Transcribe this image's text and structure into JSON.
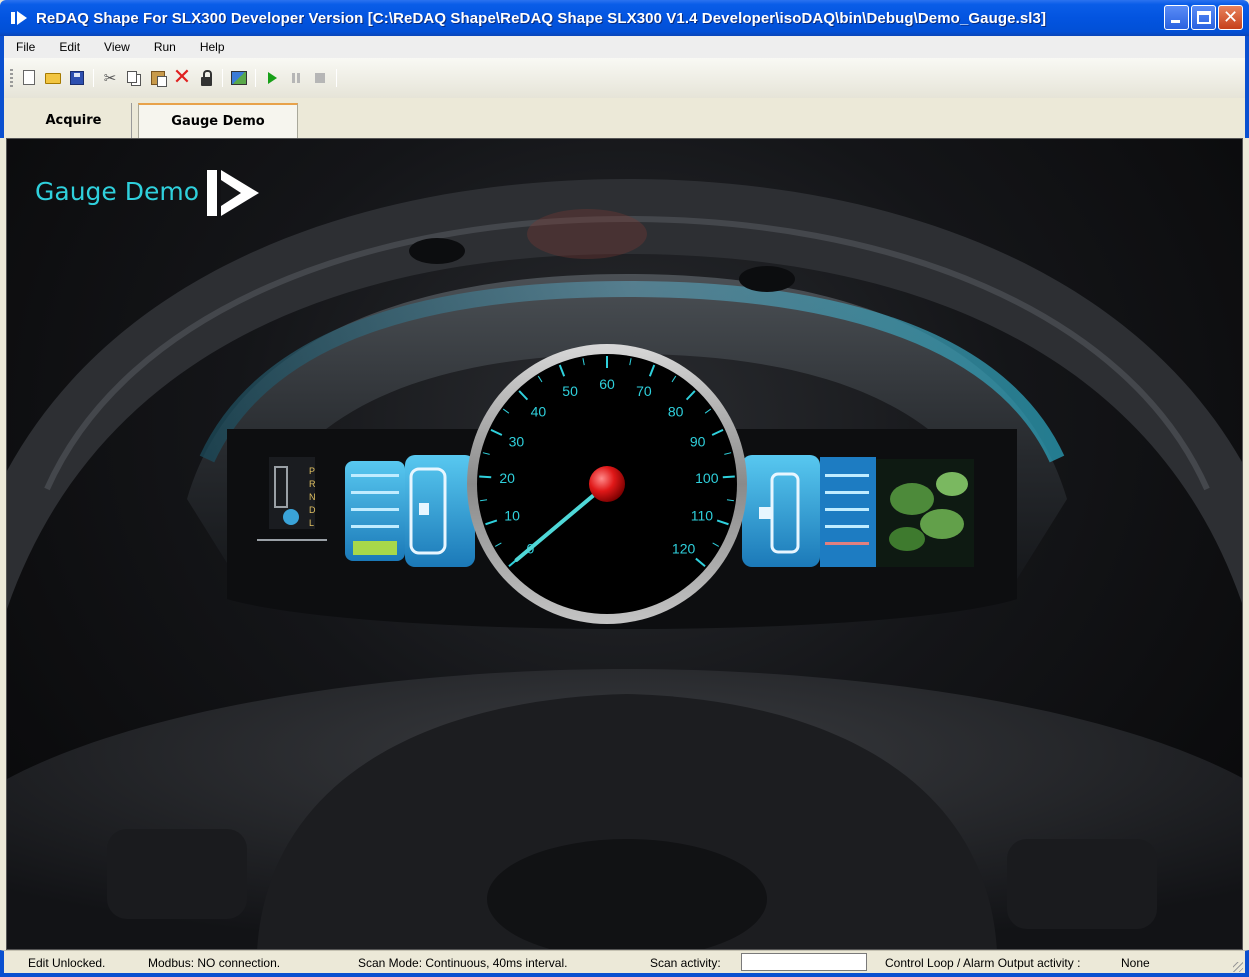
{
  "window": {
    "title": "ReDAQ Shape For SLX300 Developer Version [C:\\ReDAQ Shape\\ReDAQ Shape SLX300 V1.4 Developer\\isoDAQ\\bin\\Debug\\Demo_Gauge.sl3]",
    "icon": "redaq-logo-icon",
    "accent": "#0a50d0"
  },
  "menu": {
    "items": [
      {
        "label": "File"
      },
      {
        "label": "Edit"
      },
      {
        "label": "View"
      },
      {
        "label": "Run"
      },
      {
        "label": "Help"
      }
    ]
  },
  "toolbar": {
    "buttons": [
      "new-icon",
      "open-icon",
      "save-icon",
      "cut-icon",
      "copy-icon",
      "paste-icon",
      "delete-icon",
      "lock-icon",
      "image-icon",
      "play-icon",
      "pause-icon",
      "stop-icon"
    ]
  },
  "tabs": [
    {
      "label": "Acquire",
      "active": false
    },
    {
      "label": "Gauge Demo",
      "active": true
    }
  ],
  "canvas": {
    "title": "Gauge Demo",
    "title_color": "#2fd0dc",
    "gauge": {
      "min": 0,
      "max": 120,
      "major_step": 10,
      "labels": [
        "0",
        "10",
        "20",
        "30",
        "40",
        "50",
        "60",
        "70",
        "80",
        "90",
        "100",
        "110",
        "120"
      ],
      "value": 0,
      "needle_color": "#4fd8d8",
      "hub_color": "#e01818"
    }
  },
  "status": {
    "edit": "Edit Unlocked.",
    "modbus": "Modbus: NO connection.",
    "scan_mode": "Scan Mode: Continuous, 40ms interval.",
    "scan_activity": "Scan activity:",
    "control_loop": "Control Loop / Alarm Output activity :",
    "control_loop_value": "None"
  }
}
